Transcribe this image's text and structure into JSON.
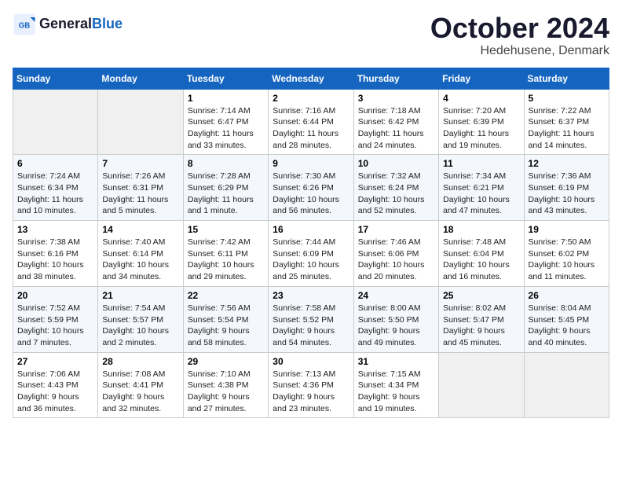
{
  "header": {
    "logo_line1": "General",
    "logo_line2": "Blue",
    "month": "October 2024",
    "location": "Hedehusene, Denmark"
  },
  "days_of_week": [
    "Sunday",
    "Monday",
    "Tuesday",
    "Wednesday",
    "Thursday",
    "Friday",
    "Saturday"
  ],
  "weeks": [
    [
      {
        "day": "",
        "info": ""
      },
      {
        "day": "",
        "info": ""
      },
      {
        "day": "1",
        "info": "Sunrise: 7:14 AM\nSunset: 6:47 PM\nDaylight: 11 hours\nand 33 minutes."
      },
      {
        "day": "2",
        "info": "Sunrise: 7:16 AM\nSunset: 6:44 PM\nDaylight: 11 hours\nand 28 minutes."
      },
      {
        "day": "3",
        "info": "Sunrise: 7:18 AM\nSunset: 6:42 PM\nDaylight: 11 hours\nand 24 minutes."
      },
      {
        "day": "4",
        "info": "Sunrise: 7:20 AM\nSunset: 6:39 PM\nDaylight: 11 hours\nand 19 minutes."
      },
      {
        "day": "5",
        "info": "Sunrise: 7:22 AM\nSunset: 6:37 PM\nDaylight: 11 hours\nand 14 minutes."
      }
    ],
    [
      {
        "day": "6",
        "info": "Sunrise: 7:24 AM\nSunset: 6:34 PM\nDaylight: 11 hours\nand 10 minutes."
      },
      {
        "day": "7",
        "info": "Sunrise: 7:26 AM\nSunset: 6:31 PM\nDaylight: 11 hours\nand 5 minutes."
      },
      {
        "day": "8",
        "info": "Sunrise: 7:28 AM\nSunset: 6:29 PM\nDaylight: 11 hours\nand 1 minute."
      },
      {
        "day": "9",
        "info": "Sunrise: 7:30 AM\nSunset: 6:26 PM\nDaylight: 10 hours\nand 56 minutes."
      },
      {
        "day": "10",
        "info": "Sunrise: 7:32 AM\nSunset: 6:24 PM\nDaylight: 10 hours\nand 52 minutes."
      },
      {
        "day": "11",
        "info": "Sunrise: 7:34 AM\nSunset: 6:21 PM\nDaylight: 10 hours\nand 47 minutes."
      },
      {
        "day": "12",
        "info": "Sunrise: 7:36 AM\nSunset: 6:19 PM\nDaylight: 10 hours\nand 43 minutes."
      }
    ],
    [
      {
        "day": "13",
        "info": "Sunrise: 7:38 AM\nSunset: 6:16 PM\nDaylight: 10 hours\nand 38 minutes."
      },
      {
        "day": "14",
        "info": "Sunrise: 7:40 AM\nSunset: 6:14 PM\nDaylight: 10 hours\nand 34 minutes."
      },
      {
        "day": "15",
        "info": "Sunrise: 7:42 AM\nSunset: 6:11 PM\nDaylight: 10 hours\nand 29 minutes."
      },
      {
        "day": "16",
        "info": "Sunrise: 7:44 AM\nSunset: 6:09 PM\nDaylight: 10 hours\nand 25 minutes."
      },
      {
        "day": "17",
        "info": "Sunrise: 7:46 AM\nSunset: 6:06 PM\nDaylight: 10 hours\nand 20 minutes."
      },
      {
        "day": "18",
        "info": "Sunrise: 7:48 AM\nSunset: 6:04 PM\nDaylight: 10 hours\nand 16 minutes."
      },
      {
        "day": "19",
        "info": "Sunrise: 7:50 AM\nSunset: 6:02 PM\nDaylight: 10 hours\nand 11 minutes."
      }
    ],
    [
      {
        "day": "20",
        "info": "Sunrise: 7:52 AM\nSunset: 5:59 PM\nDaylight: 10 hours\nand 7 minutes."
      },
      {
        "day": "21",
        "info": "Sunrise: 7:54 AM\nSunset: 5:57 PM\nDaylight: 10 hours\nand 2 minutes."
      },
      {
        "day": "22",
        "info": "Sunrise: 7:56 AM\nSunset: 5:54 PM\nDaylight: 9 hours\nand 58 minutes."
      },
      {
        "day": "23",
        "info": "Sunrise: 7:58 AM\nSunset: 5:52 PM\nDaylight: 9 hours\nand 54 minutes."
      },
      {
        "day": "24",
        "info": "Sunrise: 8:00 AM\nSunset: 5:50 PM\nDaylight: 9 hours\nand 49 minutes."
      },
      {
        "day": "25",
        "info": "Sunrise: 8:02 AM\nSunset: 5:47 PM\nDaylight: 9 hours\nand 45 minutes."
      },
      {
        "day": "26",
        "info": "Sunrise: 8:04 AM\nSunset: 5:45 PM\nDaylight: 9 hours\nand 40 minutes."
      }
    ],
    [
      {
        "day": "27",
        "info": "Sunrise: 7:06 AM\nSunset: 4:43 PM\nDaylight: 9 hours\nand 36 minutes."
      },
      {
        "day": "28",
        "info": "Sunrise: 7:08 AM\nSunset: 4:41 PM\nDaylight: 9 hours\nand 32 minutes."
      },
      {
        "day": "29",
        "info": "Sunrise: 7:10 AM\nSunset: 4:38 PM\nDaylight: 9 hours\nand 27 minutes."
      },
      {
        "day": "30",
        "info": "Sunrise: 7:13 AM\nSunset: 4:36 PM\nDaylight: 9 hours\nand 23 minutes."
      },
      {
        "day": "31",
        "info": "Sunrise: 7:15 AM\nSunset: 4:34 PM\nDaylight: 9 hours\nand 19 minutes."
      },
      {
        "day": "",
        "info": ""
      },
      {
        "day": "",
        "info": ""
      }
    ]
  ]
}
